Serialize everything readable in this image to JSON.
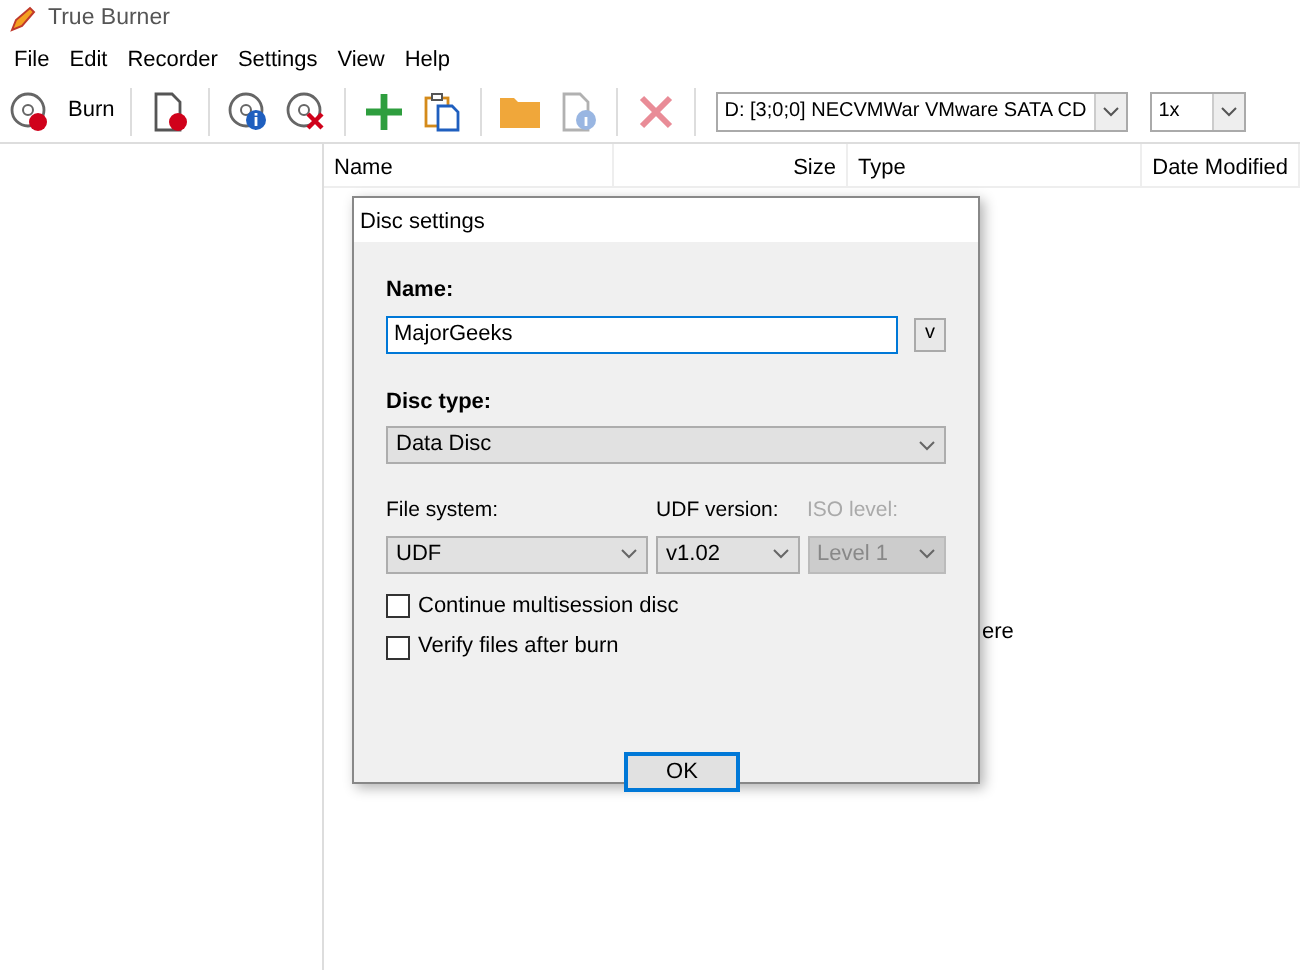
{
  "window": {
    "title": "True Burner"
  },
  "menu": [
    "File",
    "Edit",
    "Recorder",
    "Settings",
    "View",
    "Help"
  ],
  "toolbar": [
    {
      "kind": "burn",
      "label": "Burn",
      "disabled": false
    },
    {
      "kind": "new-doc",
      "disabled": false
    },
    {
      "kind": "disc-info",
      "disabled": false
    },
    {
      "kind": "disc-erase",
      "disabled": false
    },
    {
      "kind": "add",
      "disabled": false
    },
    {
      "kind": "paste",
      "disabled": false
    },
    {
      "kind": "folder",
      "disabled": false
    },
    {
      "kind": "doc-info",
      "disabled": true
    },
    {
      "kind": "delete",
      "disabled": true
    }
  ],
  "drive_select": {
    "value": "D:  [3;0;0] NECVMWar VMware SATA CD"
  },
  "speed_select": {
    "value": "1x"
  },
  "file_list": {
    "columns": [
      "Name",
      "Size",
      "Type",
      "Date Modified"
    ],
    "hint": "ere"
  },
  "dialog": {
    "title": "Disc settings",
    "name": {
      "label": "Name:",
      "value": "MajorGeeks",
      "history_button": "v"
    },
    "disc_type": {
      "label": "Disc type:",
      "value": "Data Disc"
    },
    "selects": [
      {
        "label": "File system:",
        "value": "UDF",
        "disabled": false
      },
      {
        "label": "UDF version:",
        "value": "v1.02",
        "disabled": false
      },
      {
        "label": "ISO level:",
        "value": "Level 1",
        "disabled": true
      }
    ],
    "checkboxes": [
      {
        "label": "Continue multisession disc",
        "checked": false
      },
      {
        "label": "Verify files after burn",
        "checked": false
      }
    ],
    "ok_button": "OK"
  }
}
